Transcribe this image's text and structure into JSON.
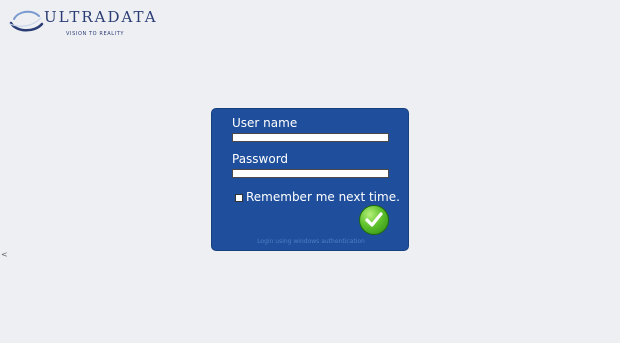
{
  "brand": {
    "name": "ULTRADATA",
    "tagline": "VISION TO REALITY",
    "logo_icon": "swoosh-logo-icon",
    "color": "#2a3d74"
  },
  "side_arrow": "<",
  "login": {
    "username_label": "User name",
    "username_value": "",
    "password_label": "Password",
    "password_value": "",
    "remember_label": "Remember me next time.",
    "remember_checked": false,
    "submit_icon": "checkmark-icon",
    "windows_auth_link": "Login using windows authentication",
    "panel_color": "#1f4f9c",
    "button_color": "#5fc12c"
  }
}
